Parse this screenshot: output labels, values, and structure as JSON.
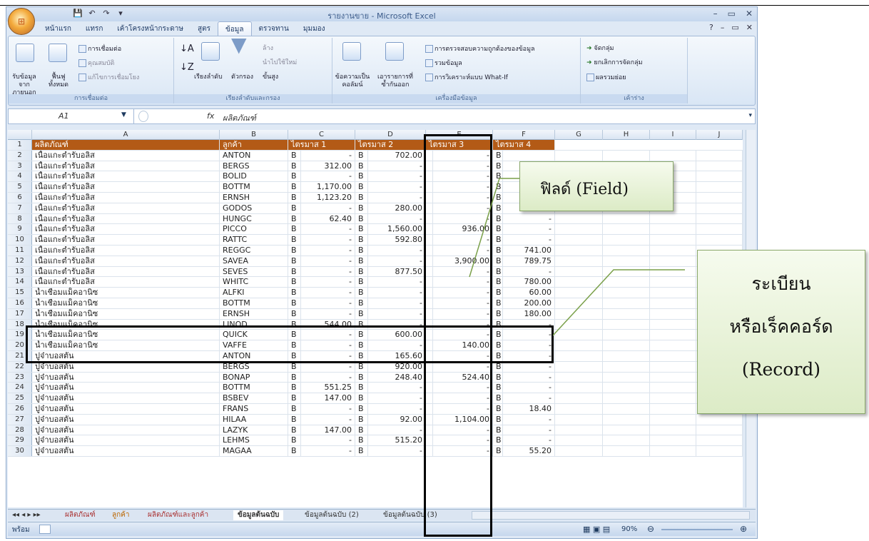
{
  "window": {
    "title": "รายงานขาย - Microsoft Excel",
    "controls": [
      "–",
      "▭",
      "✕"
    ],
    "doc_controls": [
      "?",
      "–",
      "▭",
      "✕"
    ]
  },
  "menu_tabs": [
    "หน้าแรก",
    "แทรก",
    "เค้าโครงหน้ากระดาษ",
    "สูตร",
    "ข้อมูล",
    "ตรวจทาน",
    "มุมมอง"
  ],
  "ribbon": {
    "groups": [
      {
        "label": "การเชื่อมต่อ",
        "items": [
          "รับข้อมูลจากภายนอก",
          "ฟื้นฟูทั้งหมด",
          "การเชื่อมต่อ",
          "คุณสมบัติ",
          "แก้ไขการเชื่อมโยง"
        ]
      },
      {
        "label": "เรียงลำดับและกรอง",
        "items": [
          "เรียงลำดับ",
          "ตัวกรอง",
          "ล้าง",
          "นำไปใช้ใหม่",
          "ขั้นสูง"
        ]
      },
      {
        "label": "เครื่องมือข้อมูล",
        "items": [
          "ข้อความเป็นคอลัมน์",
          "เอารายการที่ซ้ำกันออก",
          "การตรวจสอบความถูกต้องของข้อมูล",
          "รวมข้อมูล",
          "การวิเคราะห์แบบ What-If"
        ]
      },
      {
        "label": "เค้าร่าง",
        "items": [
          "จัดกลุ่ม",
          "ยกเลิกการจัดกลุ่ม",
          "ผลรวมย่อย"
        ]
      }
    ]
  },
  "formula_bar": {
    "name_box": "A1",
    "fx": "fx",
    "value": "ผลิตภัณฑ์"
  },
  "columns": [
    "A",
    "B",
    "C",
    "D",
    "E",
    "F",
    "G",
    "H",
    "I",
    "J"
  ],
  "header_row": [
    "ผลิตภัณฑ์",
    "ลูกค้า",
    "ไตรมาส 1",
    "ไตรมาส 2",
    "ไตรมาส 3",
    "ไตรมาส 4"
  ],
  "rows": [
    [
      "2",
      "เนื้อแกะตำรับอลิส",
      "ANTON",
      "B",
      "-",
      "B",
      "702.00",
      "",
      "-",
      "B",
      ""
    ],
    [
      "3",
      "เนื้อแกะตำรับอลิส",
      "BERGS",
      "B",
      "312.00",
      "B",
      "-",
      "",
      "-",
      "B",
      ""
    ],
    [
      "4",
      "เนื้อแกะตำรับอลิส",
      "BOLID",
      "B",
      "-",
      "B",
      "-",
      "",
      "-",
      "B",
      "1,"
    ],
    [
      "5",
      "เนื้อแกะตำรับอลิส",
      "BOTTM",
      "B",
      "1,170.00",
      "B",
      "-",
      "",
      "-",
      "B",
      ""
    ],
    [
      "6",
      "เนื้อแกะตำรับอลิส",
      "ERNSH",
      "B",
      "1,123.20",
      "B",
      "-",
      "",
      "-",
      "B",
      "2,"
    ],
    [
      "7",
      "เนื้อแกะตำรับอลิส",
      "GODOS",
      "B",
      "-",
      "B",
      "280.00",
      "",
      "-",
      "B",
      ""
    ],
    [
      "8",
      "เนื้อแกะตำรับอลิส",
      "HUNGC",
      "B",
      "62.40",
      "B",
      "-",
      "",
      "-",
      "B",
      "-"
    ],
    [
      "9",
      "เนื้อแกะตำรับอลิส",
      "PICCO",
      "B",
      "-",
      "B",
      "1,560.00",
      "",
      "936.00",
      "B",
      "-"
    ],
    [
      "10",
      "เนื้อแกะตำรับอลิส",
      "RATTC",
      "B",
      "-",
      "B",
      "592.80",
      "",
      "-",
      "B",
      "-"
    ],
    [
      "11",
      "เนื้อแกะตำรับอลิส",
      "REGGC",
      "B",
      "-",
      "B",
      "-",
      "",
      "-",
      "B",
      "741.00"
    ],
    [
      "12",
      "เนื้อแกะตำรับอลิส",
      "SAVEA",
      "B",
      "-",
      "B",
      "-",
      "",
      "3,900.00",
      "B",
      "789.75"
    ],
    [
      "13",
      "เนื้อแกะตำรับอลิส",
      "SEVES",
      "B",
      "-",
      "B",
      "877.50",
      "",
      "-",
      "B",
      "-"
    ],
    [
      "14",
      "เนื้อแกะตำรับอลิส",
      "WHITC",
      "B",
      "-",
      "B",
      "-",
      "",
      "-",
      "B",
      "780.00"
    ],
    [
      "15",
      "น้ำเชื่อมแม็คอานิซ",
      "ALFKI",
      "B",
      "-",
      "B",
      "-",
      "",
      "-",
      "B",
      "60.00"
    ],
    [
      "16",
      "น้ำเชื่อมแม็คอานิซ",
      "BOTTM",
      "B",
      "-",
      "B",
      "-",
      "",
      "-",
      "B",
      "200.00"
    ],
    [
      "17",
      "น้ำเชื่อมแม็คอานิซ",
      "ERNSH",
      "B",
      "-",
      "B",
      "-",
      "",
      "-",
      "B",
      "180.00"
    ],
    [
      "18",
      "น้ำเชื่อมแม็คอานิซ",
      "LINOD",
      "B",
      "544.00",
      "B",
      "-",
      "",
      "-",
      "B",
      "-"
    ],
    [
      "19",
      "น้ำเชื่อมแม็คอานิซ",
      "QUICK",
      "B",
      "-",
      "B",
      "600.00",
      "",
      "-",
      "B",
      "-"
    ],
    [
      "20",
      "น้ำเชื่อมแม็คอานิซ",
      "VAFFE",
      "B",
      "-",
      "B",
      "-",
      "",
      "140.00",
      "B",
      "-"
    ],
    [
      "21",
      "ปูจ๋าบอสตัน",
      "ANTON",
      "B",
      "-",
      "B",
      "165.60",
      "",
      "-",
      "B",
      "-"
    ],
    [
      "22",
      "ปูจ๋าบอสตัน",
      "BERGS",
      "B",
      "-",
      "B",
      "920.00",
      "",
      "-",
      "B",
      "-"
    ],
    [
      "23",
      "ปูจ๋าบอสตัน",
      "BONAP",
      "B",
      "-",
      "B",
      "248.40",
      "",
      "524.40",
      "B",
      "-"
    ],
    [
      "24",
      "ปูจ๋าบอสตัน",
      "BOTTM",
      "B",
      "551.25",
      "B",
      "-",
      "",
      "-",
      "B",
      "-"
    ],
    [
      "25",
      "ปูจ๋าบอสตัน",
      "BSBEV",
      "B",
      "147.00",
      "B",
      "-",
      "",
      "-",
      "B",
      "-"
    ],
    [
      "26",
      "ปูจ๋าบอสตัน",
      "FRANS",
      "B",
      "-",
      "B",
      "-",
      "",
      "-",
      "B",
      "18.40"
    ],
    [
      "27",
      "ปูจ๋าบอสตัน",
      "HILAA",
      "B",
      "-",
      "B",
      "92.00",
      "",
      "1,104.00",
      "B",
      "-"
    ],
    [
      "28",
      "ปูจ๋าบอสตัน",
      "LAZYK",
      "B",
      "147.00",
      "B",
      "-",
      "",
      "-",
      "B",
      "-"
    ],
    [
      "29",
      "ปูจ๋าบอสตัน",
      "LEHMS",
      "B",
      "-",
      "B",
      "515.20",
      "",
      "-",
      "B",
      "-"
    ],
    [
      "30",
      "ปูจ๋าบอสตัน",
      "MAGAA",
      "B",
      "-",
      "B",
      "-",
      "",
      "-",
      "B",
      "55.20"
    ]
  ],
  "sheet_tabs": [
    "ผลิตภัณฑ์",
    "ลูกค้า",
    "ผลิตภัณฑ์และลูกค้า",
    "ข้อมูลต้นฉบับ",
    "ข้อมูลต้นฉบับ (2)",
    "ข้อมูลต้นฉบับ (3)"
  ],
  "status": {
    "ready": "พร้อม",
    "zoom": "90%"
  },
  "annotations": {
    "field": "ฟิลด์ (Field)",
    "record_line1": "ระเบียน",
    "record_line2": "หรือเร็คคอร์ด",
    "record_line3": "(Record)"
  },
  "colors": {
    "header_fill": "#b35a16",
    "ribbon": "#d9e6f5",
    "callout": "#dcebc6"
  }
}
